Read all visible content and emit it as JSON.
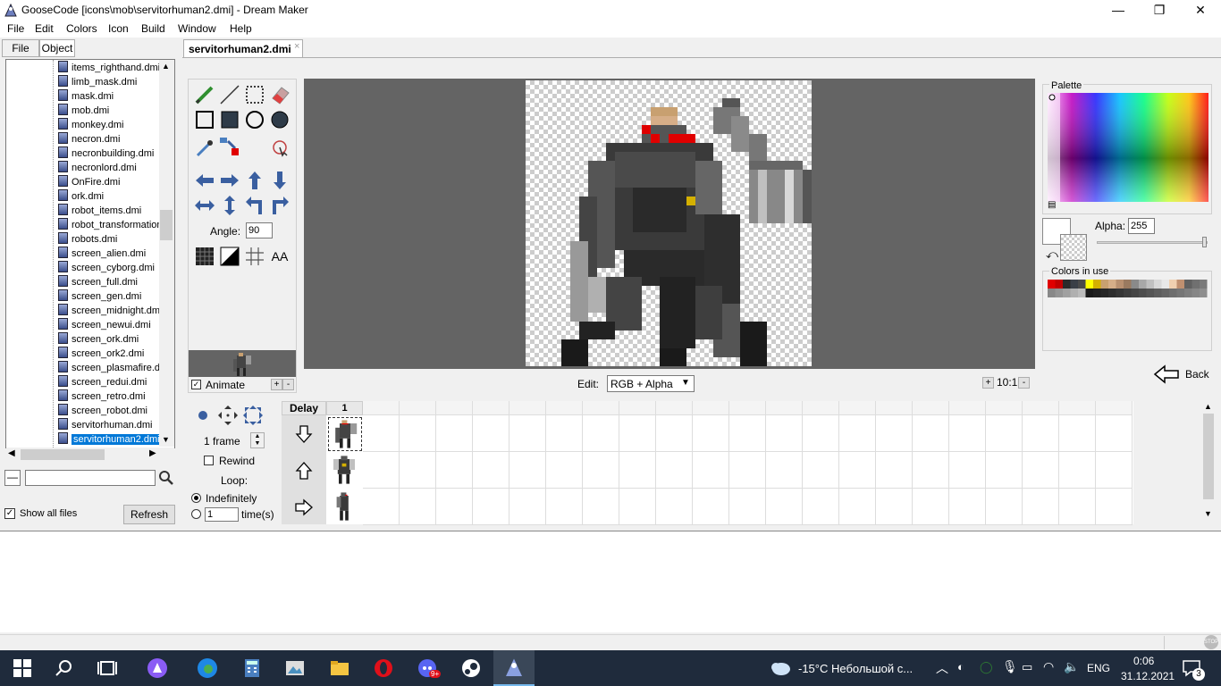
{
  "window": {
    "title": "GooseCode [icons\\mob\\servitorhuman2.dmi] - Dream Maker",
    "minimize": "—",
    "maximize": "❐",
    "close": "✕"
  },
  "menu": [
    "File",
    "Edit",
    "Colors",
    "Icon",
    "Build",
    "Window",
    "Help"
  ],
  "left_tabs": [
    "File",
    "Object"
  ],
  "files": [
    "items_righthand.dmi",
    "limb_mask.dmi",
    "mask.dmi",
    "mob.dmi",
    "monkey.dmi",
    "necron.dmi",
    "necronbuilding.dmi",
    "necronlord.dmi",
    "OnFire.dmi",
    "ork.dmi",
    "robot_items.dmi",
    "robot_transformation",
    "robots.dmi",
    "screen_alien.dmi",
    "screen_cyborg.dmi",
    "screen_full.dmi",
    "screen_gen.dmi",
    "screen_midnight.dm",
    "screen_newui.dmi",
    "screen_ork.dmi",
    "screen_ork2.dmi",
    "screen_plasmafire.d",
    "screen_redui.dmi",
    "screen_retro.dmi",
    "screen_robot.dmi",
    "servitorhuman.dmi",
    "servitorhuman2.dmi"
  ],
  "selected_file": "servitorhuman2.dmi",
  "search": {
    "value": ""
  },
  "show_all_files": "Show all files",
  "refresh": "Refresh",
  "doc_tab": {
    "label": "servitorhuman2.dmi",
    "close": "×"
  },
  "tools": {
    "angle_label": "Angle:",
    "angle_value": "90",
    "aa_label": "AA",
    "animate": "Animate",
    "plus": "+",
    "minus": "-"
  },
  "edit": {
    "label": "Edit:",
    "mode": "RGB + Alpha",
    "zoom": "10:1"
  },
  "palette": {
    "label": "Palette",
    "alpha_label": "Alpha:",
    "alpha_value": "255",
    "colors_in_use": "Colors in use",
    "back": "Back"
  },
  "frames": {
    "delay_header": "Delay",
    "col1_header": "1",
    "frame_count": "1 frame",
    "rewind": "Rewind",
    "loop": "Loop:",
    "indefinitely": "Indefinitely",
    "times_value": "1",
    "times": "time(s)"
  },
  "taskbar": {
    "weather": "-15°C  Небольшой с...",
    "lang": "ENG",
    "time": "0:06",
    "date": "31.12.2021",
    "notif_count": "3",
    "chat_badge": "9+"
  },
  "colors_in_use": [
    "#e00000",
    "#c00000",
    "#2a2a2a",
    "#3a3f47",
    "#4a4a4a",
    "#ffff00",
    "#d4b000",
    "#c8a070",
    "#d6ae88",
    "#b89070",
    "#9a7a60",
    "#8a8a8a",
    "#a8a8a8",
    "#c0c0c0",
    "#d8d8d8",
    "#e8e8e8",
    "#f0d0b0",
    "#c09070",
    "#606060",
    "#707070",
    "#7a7a7a",
    "#888888",
    "#949494",
    "#a0a0a0",
    "#b0b0b0",
    "#bcbcbc",
    "#1a1a1a",
    "#202020",
    "#262626",
    "#2e2e2e",
    "#363636",
    "#3e3e3e",
    "#464646",
    "#4e4e4e",
    "#565656",
    "#5e5e5e",
    "#666666",
    "#6e6e6e",
    "#767676",
    "#7e7e7e",
    "#868686",
    "#8e8e8e"
  ]
}
